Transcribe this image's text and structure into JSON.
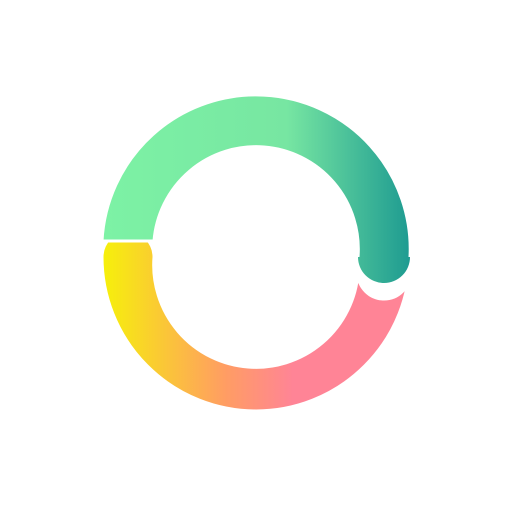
{
  "icon": {
    "name": "ring-logo",
    "colors": {
      "top_start": "#7DF2A5",
      "top_mid": "#77E6A2",
      "top_end": "#1E9B91",
      "bottom_start": "#F6F10A",
      "bottom_mid": "#FF9D63",
      "bottom_end": "#FF8496",
      "background": "#FFFFFF"
    }
  }
}
